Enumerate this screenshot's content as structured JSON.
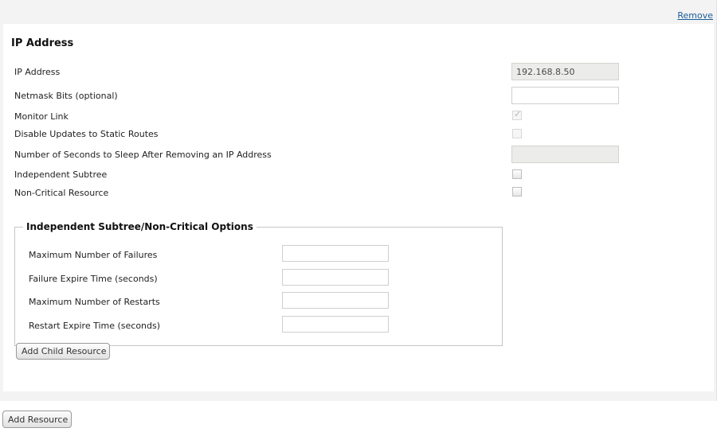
{
  "header": {
    "remove_label": "Remove",
    "section_title": "IP Address"
  },
  "fields": {
    "ip_address": {
      "label": "IP Address",
      "value": "192.168.8.50"
    },
    "netmask_bits": {
      "label": "Netmask Bits (optional)",
      "value": ""
    },
    "monitor_link": {
      "label": "Monitor Link",
      "checked": true,
      "check_glyph": "✓"
    },
    "disable_updates": {
      "label": "Disable Updates to Static Routes",
      "checked": false
    },
    "sleep_seconds": {
      "label": "Number of Seconds to Sleep After Removing an IP Address",
      "value": ""
    },
    "independent_subtree": {
      "label": "Independent Subtree",
      "checked": false
    },
    "non_critical": {
      "label": "Non-Critical Resource",
      "checked": false
    }
  },
  "options": {
    "legend": "Independent Subtree/Non-Critical Options",
    "max_failures": {
      "label": "Maximum Number of Failures",
      "value": ""
    },
    "failure_expire": {
      "label": "Failure Expire Time (seconds)",
      "value": ""
    },
    "max_restarts": {
      "label": "Maximum Number of Restarts",
      "value": ""
    },
    "restart_expire": {
      "label": "Restart Expire Time (seconds)",
      "value": ""
    }
  },
  "buttons": {
    "add_child_resource": "Add Child Resource",
    "add_resource": "Add Resource"
  }
}
